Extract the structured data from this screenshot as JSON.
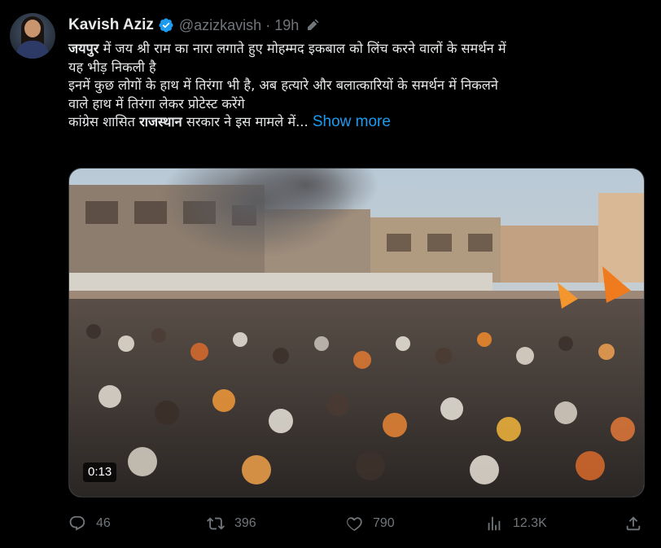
{
  "tweet": {
    "author_name": "Kavish Aziz",
    "handle": "@azizkavish",
    "separator": "·",
    "time": "19h",
    "text": {
      "line1_bold": "जयपुर",
      "line1_rest": " में जय श्री राम का नारा लगाते हुए मोहम्मद इकबाल को लिंच करने वालों के समर्थन में",
      "line2": "यह भीड़ निकली है",
      "line3": "इनमें कुछ लोगों के हाथ में तिरंगा भी है, अब हत्यारे और बलात्कारियों के समर्थन में निकलने",
      "line4": "वाले हाथ में तिरंगा लेकर प्रोटेस्ट करेंगे",
      "line5_pre": "कांग्रेस शासित ",
      "line5_bold": "राजस्थान",
      "line5_rest": " सरकार ने इस मामले में..."
    },
    "show_more": "Show more",
    "media": {
      "duration": "0:13"
    },
    "actions": {
      "replies": "46",
      "reposts": "396",
      "likes": "790",
      "views": "12.3K"
    },
    "icons": {
      "verified": "verified-badge-icon",
      "edit": "edit-pencil-icon",
      "reply": "reply-icon",
      "repost": "repost-icon",
      "like": "heart-icon",
      "views": "views-chart-icon",
      "share": "share-icon"
    },
    "colors": {
      "background": "#000000",
      "text": "#e7e9ea",
      "secondary": "#71767b",
      "accent": "#1d9bf0"
    }
  }
}
